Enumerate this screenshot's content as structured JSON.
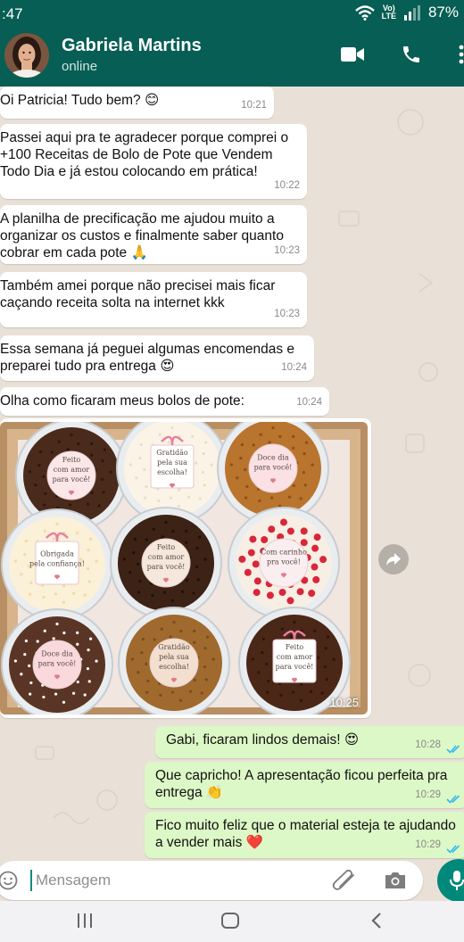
{
  "status_bar": {
    "time": ":47",
    "volte_top": "Vo)",
    "volte_bottom": "LTE",
    "battery": "87%"
  },
  "header": {
    "contact_name": "Gabriela Martins",
    "contact_status": "online"
  },
  "messages": [
    {
      "text": "Oi Patricia! Tudo bem? 😊",
      "time": "10:21"
    },
    {
      "text": "Passei aqui pra te agradecer porque comprei o +100 Receitas de Bolo de Pote que Vendem Todo Dia e já estou colocando em prática!",
      "time": "10:22"
    },
    {
      "text": "A planilha de precificação me ajudou muito a organizar os custos e finalmente saber quanto cobrar em cada pote 🙏",
      "time": "10:23"
    },
    {
      "text": "Também amei porque não precisei mais ficar caçando receita solta na internet kkk",
      "time": "10:23"
    },
    {
      "text": "Essa semana já peguei algumas encomendas e preparei tudo pra entrega 😍",
      "time": "10:24"
    },
    {
      "text": "Olha como ficaram meus bolos de pote:",
      "time": "10:24"
    },
    {
      "time": "10:25",
      "tags": [
        [
          "Feito",
          "com amor",
          "para você!"
        ],
        [
          "Gratidão",
          "pela sua",
          "escolha!"
        ],
        [
          "Doce dia",
          "para você!"
        ],
        [
          "Obrigada",
          "pela confiança!"
        ],
        [
          "Feito",
          "com amor",
          "para você!"
        ],
        [
          "Com carinho",
          "pra você!"
        ],
        [
          "Doce dia",
          "para você!"
        ],
        [
          "Gratidão",
          "pela sua",
          "escolha!"
        ],
        [
          "Feito",
          "com amor",
          "para você!"
        ]
      ]
    },
    {
      "text": "Gabi, ficaram lindos demais! 😍",
      "time": "10:28"
    },
    {
      "text": "Que capricho! A apresentação ficou perfeita pra entrega 👏",
      "time": "10:29"
    },
    {
      "text": "Fico muito feliz que o material esteja te ajudando a vender mais ❤️",
      "time": "10:29"
    }
  ],
  "composer": {
    "placeholder": "Mensagem"
  },
  "colors": {
    "header": "#075e54",
    "outgoing_bubble": "#dcf8c6",
    "read_ticks": "#34b7f1",
    "accent": "#00897b"
  },
  "icons": [
    "video-call-icon",
    "phone-icon",
    "more-options-icon",
    "emoji-icon",
    "attach-icon",
    "camera-icon",
    "mic-icon",
    "forward-icon",
    "nav-recents-icon",
    "nav-home-icon",
    "nav-back-icon"
  ]
}
